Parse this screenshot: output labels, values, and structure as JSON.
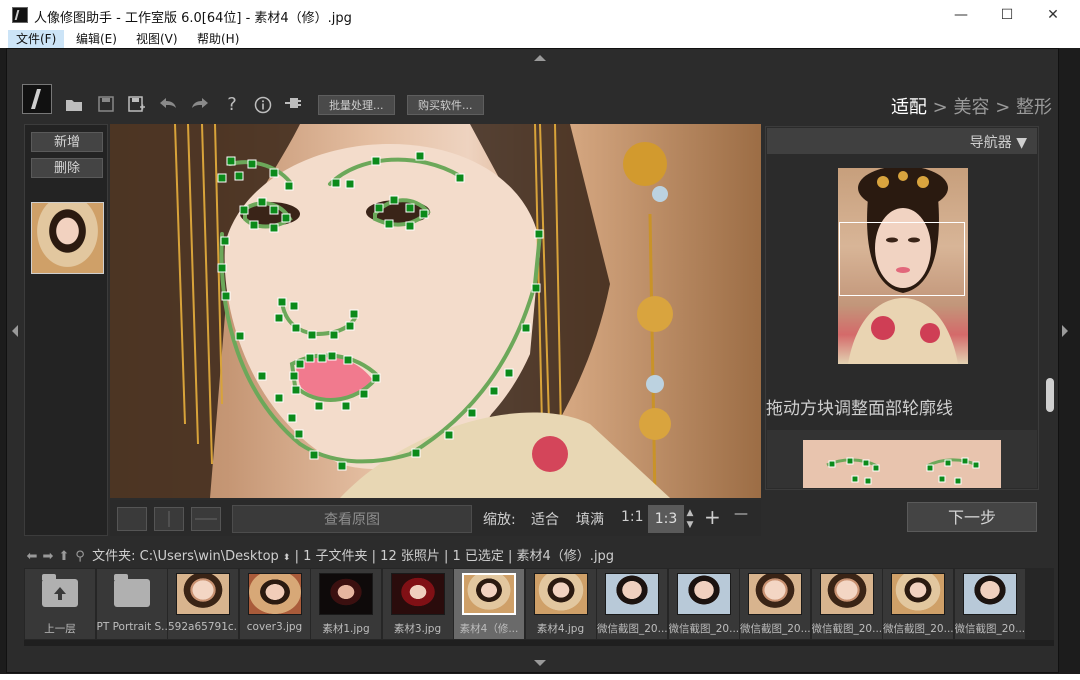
{
  "window": {
    "title": "人像修图助手 - 工作室版 6.0[64位] - 素材4（修）.jpg",
    "minimize": "—",
    "maximize": "☐",
    "close": "✕"
  },
  "menu": [
    "文件(F)",
    "编辑(E)",
    "视图(V)",
    "帮助(H)"
  ],
  "toolbar": {
    "batch": "批量处理...",
    "buy": "购买软件...",
    "steps": {
      "step1": "适配",
      "sep": " > ",
      "step2": "美容",
      "step3": "整形"
    }
  },
  "left_panel": {
    "add": "新增",
    "delete": "删除"
  },
  "canvas_footer": {
    "view_original": "查看原图",
    "zoom_label": "缩放:",
    "fit": "适合",
    "fill": "填满",
    "one_to_one": "1:1",
    "zoom_value": "1:3",
    "plus": "+",
    "minus": "—"
  },
  "navigator": {
    "title": "导航器 ▼",
    "hint": "拖动方块调整面部轮廓线"
  },
  "next": "下一步",
  "pathbar": {
    "folder_label": "文件夹:",
    "path": "C:\\Users\\win\\Desktop",
    "info": "| 1 子文件夹 | 12 张照片 | 1 已选定 | 素材4（修）.jpg"
  },
  "filmstrip": [
    {
      "label": "上一层",
      "kind": "up"
    },
    {
      "label": "PT Portrait S...",
      "kind": "folder"
    },
    {
      "label": "592a65791c...",
      "kind": "photo",
      "img": "photo-a"
    },
    {
      "label": "cover3.jpg",
      "kind": "photo",
      "img": "photo-b"
    },
    {
      "label": "素材1.jpg",
      "kind": "photo",
      "img": "photo-d"
    },
    {
      "label": "素材3.jpg",
      "kind": "photo",
      "img": "photo-e"
    },
    {
      "label": "素材4（修...",
      "kind": "photo",
      "img": "photo-f",
      "selected": true
    },
    {
      "label": "素材4.jpg",
      "kind": "photo",
      "img": "photo-f"
    },
    {
      "label": "微信截图_20...",
      "kind": "photo",
      "img": "photo-c"
    },
    {
      "label": "微信截图_20...",
      "kind": "photo",
      "img": "photo-c"
    },
    {
      "label": "微信截图_20...",
      "kind": "photo",
      "img": "photo-a"
    },
    {
      "label": "微信截图_20...",
      "kind": "photo",
      "img": "photo-a"
    },
    {
      "label": "微信截图_20...",
      "kind": "photo",
      "img": "photo-f"
    },
    {
      "label": "微信截图_20...",
      "kind": "photo",
      "img": "photo-c"
    }
  ],
  "colors": {
    "background": "#2c2c2c",
    "accent_green": "#0b8a1a",
    "contour_green": "#6ca85a"
  }
}
